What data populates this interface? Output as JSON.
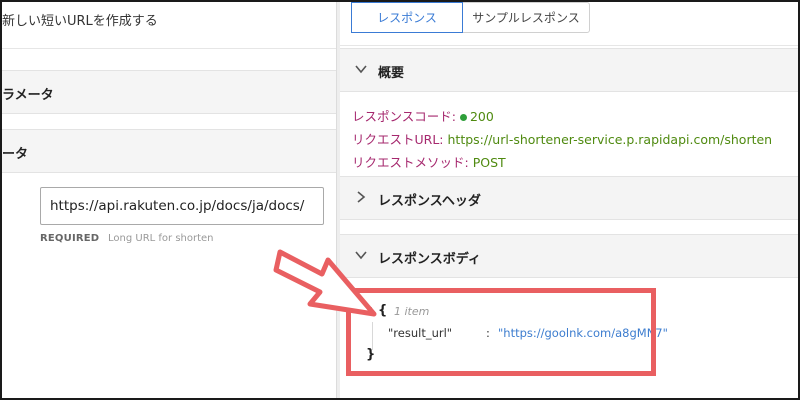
{
  "left_panel": {
    "description": "新しい短いURLを作成する",
    "params_section": "ラメータ",
    "body_section": "ータ",
    "url_field": {
      "value": "https://api.rakuten.co.jp/docs/ja/docs/",
      "required_label": "REQUIRED",
      "hint": "Long URL for shorten"
    }
  },
  "right_panel": {
    "tabs": [
      {
        "label": "レスポンス",
        "active": true
      },
      {
        "label": "サンプルレスポンス",
        "active": false
      }
    ],
    "overview": {
      "title": "概要",
      "status_label": "レスポンスコード:",
      "status_value": "200",
      "url_label": "リクエストURL:",
      "url_value": "https://url-shortener-service.p.rapidapi.com/shorten",
      "method_label": "リクエストメソッド:",
      "method_value": "POST"
    },
    "headers_section": "レスポンスヘッダ",
    "body_section": "レスポンスボディ",
    "json": {
      "open_brace": "{",
      "item_count": "1 item",
      "key": "\"result_url\"",
      "separator": ":",
      "value": "\"https://goolnk.com/a8gMN7\"",
      "close_brace": "}"
    }
  },
  "colors": {
    "annotation": "#e95f61",
    "accent": "#3a7bd5",
    "key_color": "#a6286e",
    "value_color": "#4f8a10",
    "status_dot": "#2e9f3a",
    "json_string": "#3d7dcf"
  },
  "icons": {
    "overview_toggle": "chevron-down-icon",
    "headers_toggle": "chevron-right-icon",
    "body_toggle": "chevron-down-icon",
    "json_toggle": "caret-down-icon",
    "annotation_arrow": "arrow-icon"
  }
}
